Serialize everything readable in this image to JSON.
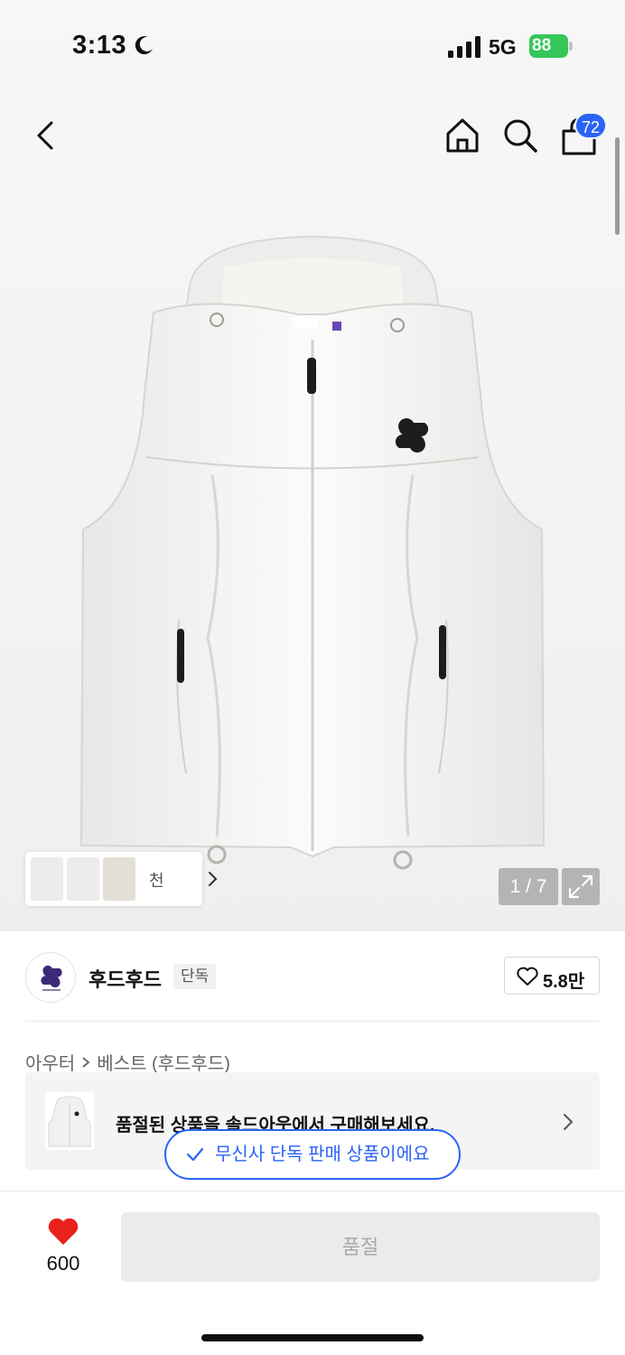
{
  "status_bar": {
    "time": "3:13",
    "network": "5G",
    "battery": "88"
  },
  "nav": {
    "cart_count": "72"
  },
  "gallery": {
    "thumb_label": "천",
    "page_counter": "1 / 7"
  },
  "brand": {
    "name": "후드후드",
    "badge": "단독",
    "like_count": "5.8만"
  },
  "breadcrumb": {
    "category": "아우터",
    "subcategory": "베스트 (후드후드)"
  },
  "soldout_banner": {
    "text": "품절된 상품을 솔드아웃에서 구매해보세요."
  },
  "exclusive_pill": {
    "text": "무신사 단독 판매 상품이에요"
  },
  "bottom_bar": {
    "heart_count": "600",
    "cta_label": "품절"
  },
  "colors": {
    "accent": "#2a64f6",
    "heart": "#e8211c",
    "battery": "#34c759"
  }
}
